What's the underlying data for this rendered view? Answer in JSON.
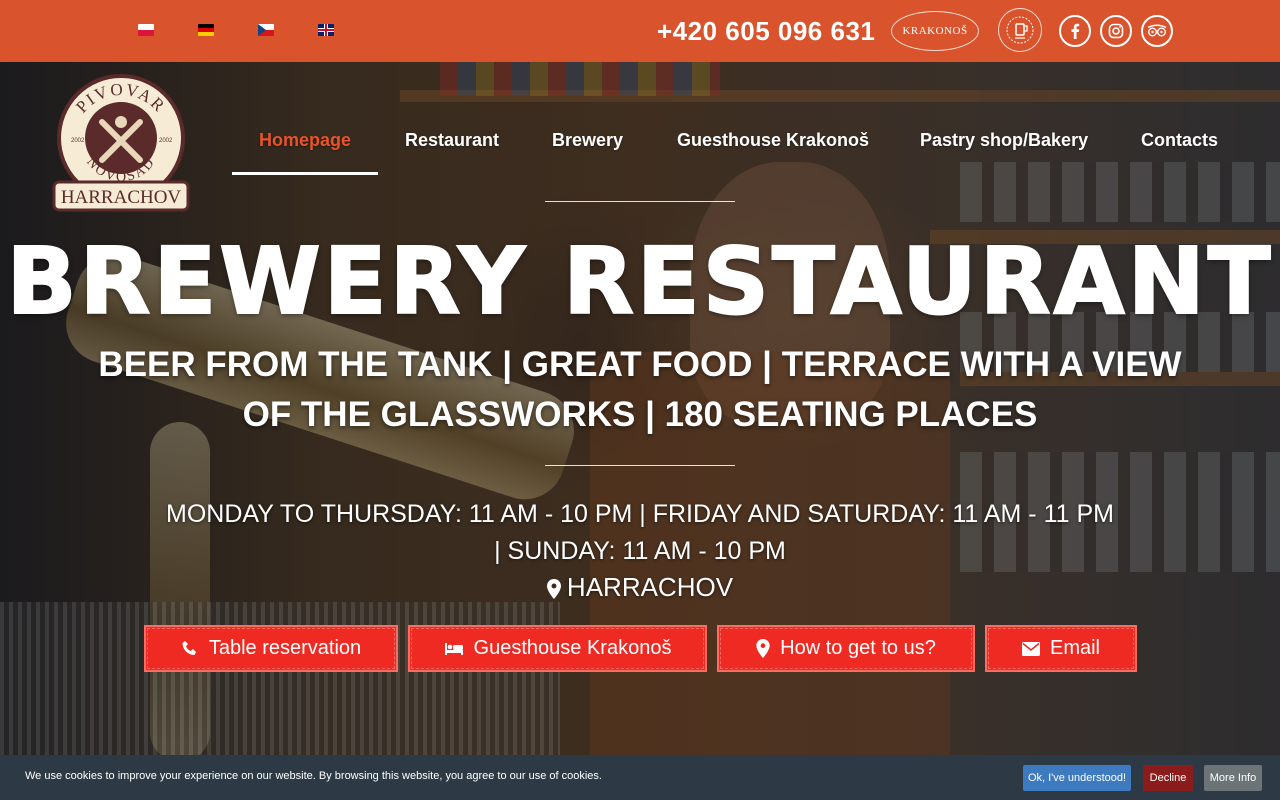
{
  "topbar": {
    "languages": [
      {
        "code": "pl",
        "name": "Polski"
      },
      {
        "code": "de",
        "name": "Deutsch"
      },
      {
        "code": "cz",
        "name": "Čeština"
      },
      {
        "code": "gb",
        "name": "English"
      }
    ],
    "phone": "+420 605 096 631",
    "partner_badge": "KRAKONOŠ",
    "social": [
      "facebook-icon",
      "instagram-icon",
      "tripadvisor-icon"
    ]
  },
  "logo": {
    "top_text": "PIVOVAR",
    "middle_text": "NOVOSAD",
    "bottom_text": "HARRACHOV",
    "year_left": "2002",
    "year_right": "2002"
  },
  "nav": {
    "items": [
      {
        "label": "Homepage",
        "active": true
      },
      {
        "label": "Restaurant",
        "active": false
      },
      {
        "label": "Brewery",
        "active": false
      },
      {
        "label": "Guesthouse Krakonoš",
        "active": false
      },
      {
        "label": "Pastry shop/Bakery",
        "active": false
      },
      {
        "label": "Contacts",
        "active": false
      }
    ]
  },
  "hero": {
    "title": "BREWERY RESTAURANT",
    "tagline_line1": "BEER FROM THE TANK | GREAT FOOD | TERRACE WITH A VIEW",
    "tagline_line2": "OF THE GLASSWORKS | 180 SEATING PLACES",
    "hours_line1": "MONDAY TO THURSDAY: 11 AM - 10 PM | FRIDAY AND SATURDAY: 11 AM - 11 PM",
    "hours_line2": "| SUNDAY: 11 AM - 10 PM",
    "location": "HARRACHOV",
    "buttons": [
      {
        "label": "Table reservation",
        "icon": "phone-icon"
      },
      {
        "label": "Guesthouse Krakonoš",
        "icon": "bed-icon"
      },
      {
        "label": "How to get to us?",
        "icon": "map-marker-icon"
      },
      {
        "label": "Email",
        "icon": "envelope-icon"
      }
    ]
  },
  "cookie_bar": {
    "text": "We use cookies to improve your experience on our website. By browsing this website, you agree to our use of cookies.",
    "accept": "Ok, I've understood!",
    "decline": "Decline",
    "more": "More Info"
  },
  "colors": {
    "topbar": "#d9532d",
    "button": "#ee2a22",
    "nav_active": "#e8532a",
    "cookie_bg": "#2d3a45"
  }
}
